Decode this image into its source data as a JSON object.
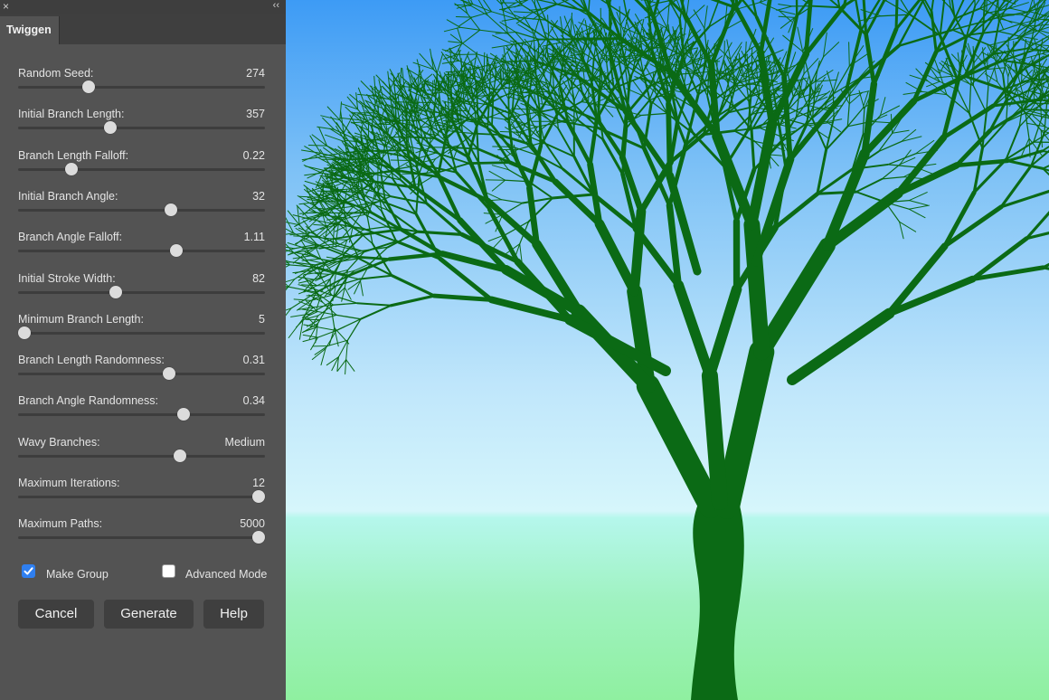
{
  "panel": {
    "tab_label": "Twiggen",
    "close_glyph": "×",
    "collapse_glyph": "‹‹",
    "sliders": [
      {
        "label": "Random Seed:",
        "value": "274",
        "position": 0.285
      },
      {
        "label": "Initial Branch Length:",
        "value": "357",
        "position": 0.375
      },
      {
        "label": "Branch Length Falloff:",
        "value": "0.22",
        "position": 0.215
      },
      {
        "label": "Initial Branch Angle:",
        "value": "32",
        "position": 0.62
      },
      {
        "label": "Branch Angle Falloff:",
        "value": "1.11",
        "position": 0.64
      },
      {
        "label": "Initial Stroke Width:",
        "value": "82",
        "position": 0.395
      },
      {
        "label": "Minimum Branch Length:",
        "value": "5",
        "position": 0.025
      },
      {
        "label": "Branch Length Randomness:",
        "value": "0.31",
        "position": 0.612
      },
      {
        "label": "Branch Angle Randomness:",
        "value": "0.34",
        "position": 0.67
      },
      {
        "label": "Wavy Branches:",
        "value": "Medium",
        "position": 0.655
      },
      {
        "label": "Maximum Iterations:",
        "value": "12",
        "position": 0.975
      },
      {
        "label": "Maximum Paths:",
        "value": "5000",
        "position": 0.975
      }
    ],
    "checkboxes": [
      {
        "label": "Make Group",
        "checked": true
      },
      {
        "label": "Advanced Mode",
        "checked": false
      }
    ],
    "buttons": {
      "cancel": "Cancel",
      "generate": "Generate",
      "help": "Help"
    }
  },
  "colors": {
    "panel_bg": "#535353",
    "tree": "#0b6a15",
    "checkbox_accent": "#2f7ff0"
  }
}
